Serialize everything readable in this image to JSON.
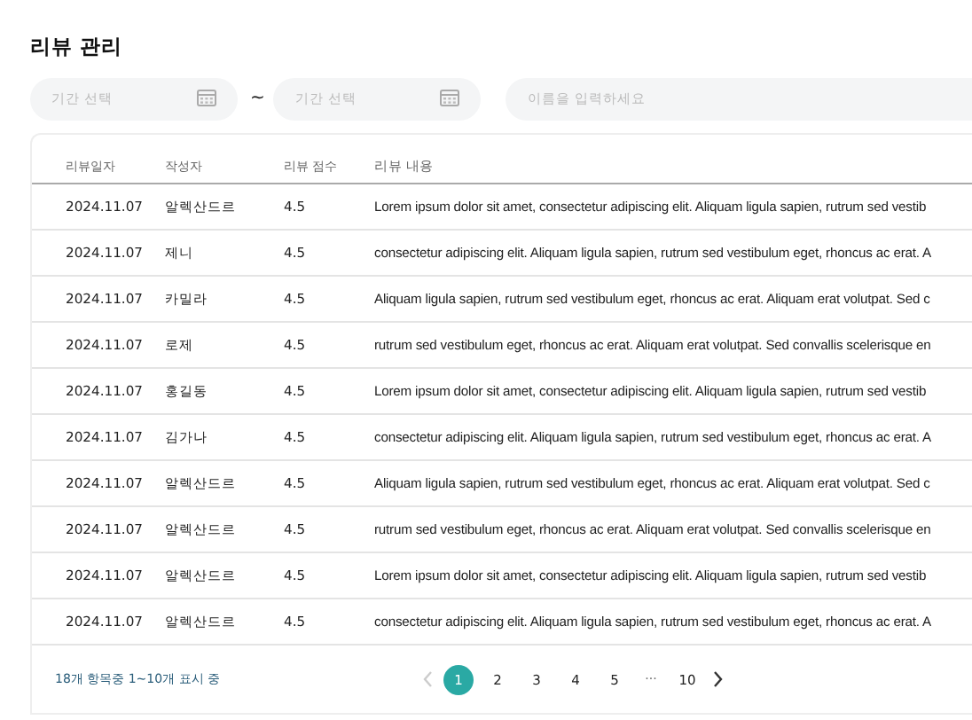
{
  "title": "리뷰 관리",
  "filters": {
    "start_date": {
      "placeholder": "기간 선택"
    },
    "separator": "~",
    "end_date": {
      "placeholder": "기간 선택"
    },
    "name_search": {
      "placeholder": "이름을 입력하세요"
    }
  },
  "table": {
    "columns": [
      "리뷰일자",
      "작성자",
      "리뷰 점수",
      "리뷰 내용"
    ],
    "rows": [
      [
        "2024.11.07",
        "알렉산드르",
        "4.5",
        "Lorem ipsum dolor sit amet, consectetur adipiscing elit. Aliquam ligula sapien, rutrum sed vestib"
      ],
      [
        "2024.11.07",
        "제니",
        "4.5",
        "consectetur adipiscing elit. Aliquam ligula sapien, rutrum sed vestibulum eget, rhoncus ac erat. A"
      ],
      [
        "2024.11.07",
        "카밀라",
        "4.5",
        "Aliquam ligula sapien, rutrum sed vestibulum eget, rhoncus ac erat. Aliquam erat volutpat. Sed c"
      ],
      [
        "2024.11.07",
        "로제",
        "4.5",
        "rutrum sed vestibulum eget, rhoncus ac erat. Aliquam erat volutpat. Sed convallis scelerisque en"
      ],
      [
        "2024.11.07",
        "홍길동",
        "4.5",
        "Lorem ipsum dolor sit amet, consectetur adipiscing elit. Aliquam ligula sapien, rutrum sed vestib"
      ],
      [
        "2024.11.07",
        "김가나",
        "4.5",
        "consectetur adipiscing elit. Aliquam ligula sapien, rutrum sed vestibulum eget, rhoncus ac erat. A"
      ],
      [
        "2024.11.07",
        "알렉산드르",
        "4.5",
        "Aliquam ligula sapien, rutrum sed vestibulum eget, rhoncus ac erat. Aliquam erat volutpat. Sed c"
      ],
      [
        "2024.11.07",
        "알렉산드르",
        "4.5",
        "rutrum sed vestibulum eget, rhoncus ac erat. Aliquam erat volutpat. Sed convallis scelerisque en"
      ],
      [
        "2024.11.07",
        "알렉산드르",
        "4.5",
        "Lorem ipsum dolor sit amet, consectetur adipiscing elit. Aliquam ligula sapien, rutrum sed vestib"
      ],
      [
        "2024.11.07",
        "알렉산드르",
        "4.5",
        "consectetur adipiscing elit. Aliquam ligula sapien, rutrum sed vestibulum eget, rhoncus ac erat. A"
      ]
    ]
  },
  "footer": {
    "summary": "18개 항목중 1~10개 표시 중",
    "pagination": {
      "prev": {
        "disabled": true
      },
      "next": {
        "disabled": false
      },
      "pages": [
        {
          "label": "1",
          "kind": "page",
          "selected": true
        },
        {
          "label": "2",
          "kind": "page",
          "selected": false
        },
        {
          "label": "3",
          "kind": "page",
          "selected": false
        },
        {
          "label": "4",
          "kind": "page",
          "selected": false
        },
        {
          "label": "5",
          "kind": "page",
          "selected": false
        },
        {
          "label": "···",
          "kind": "ellipsis",
          "selected": false
        },
        {
          "label": "10",
          "kind": "page",
          "selected": false
        }
      ]
    }
  }
}
